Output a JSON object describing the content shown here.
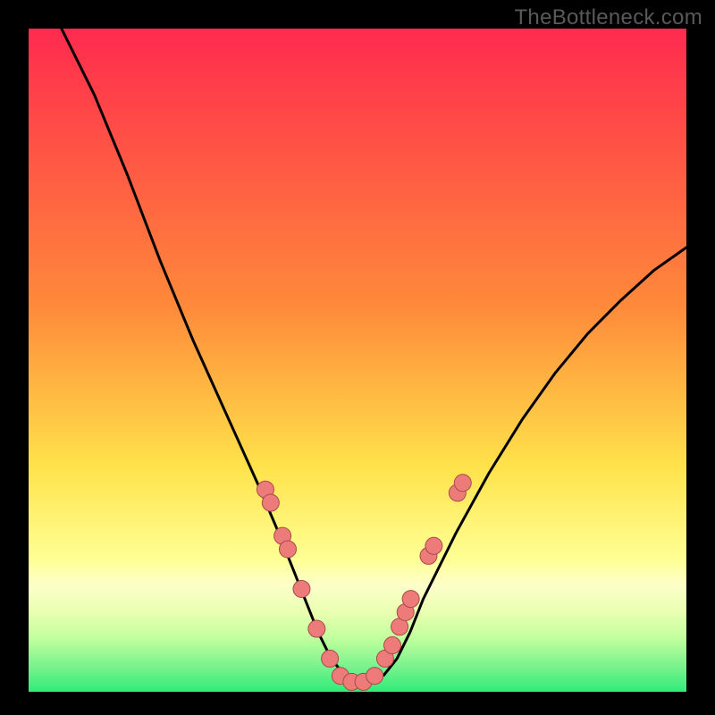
{
  "watermark": "TheBottleneck.com",
  "colors": {
    "black": "#000000",
    "gradient_top": "#ff2a4e",
    "gradient_mid1": "#ff8a3a",
    "gradient_mid2": "#ffe24a",
    "gradient_mid3": "#ffff94",
    "gradient_bottom": "#31eb79",
    "curve_stroke": "#000000",
    "dot_fill": "#ed7b7a",
    "dot_stroke": "#a84b4a"
  },
  "chart_data": {
    "type": "line",
    "title": "",
    "xlabel": "",
    "ylabel": "",
    "xlim": [
      0,
      100
    ],
    "ylim": [
      0,
      100
    ],
    "series": [
      {
        "name": "bottleneck-curve",
        "x": [
          5,
          10,
          15,
          20,
          25,
          30,
          35,
          38,
          40,
          42,
          44,
          46,
          48,
          50,
          52,
          54,
          56,
          58,
          60,
          65,
          70,
          75,
          80,
          85,
          90,
          95,
          100
        ],
        "y": [
          100,
          90,
          78,
          65,
          53,
          42,
          31,
          24,
          19,
          14,
          9,
          5,
          2.5,
          1.5,
          1.5,
          2.5,
          5,
          9,
          14,
          24,
          33,
          41,
          48,
          54,
          59,
          63.5,
          67
        ]
      }
    ],
    "dots": {
      "name": "data-markers",
      "points": [
        {
          "x": 36.0,
          "y": 30.5
        },
        {
          "x": 36.8,
          "y": 28.5
        },
        {
          "x": 38.6,
          "y": 23.5
        },
        {
          "x": 39.4,
          "y": 21.5
        },
        {
          "x": 41.5,
          "y": 15.5
        },
        {
          "x": 43.8,
          "y": 9.5
        },
        {
          "x": 45.8,
          "y": 5.0
        },
        {
          "x": 47.4,
          "y": 2.4
        },
        {
          "x": 49.1,
          "y": 1.5
        },
        {
          "x": 50.9,
          "y": 1.5
        },
        {
          "x": 52.6,
          "y": 2.4
        },
        {
          "x": 54.2,
          "y": 5.0
        },
        {
          "x": 55.3,
          "y": 7.0
        },
        {
          "x": 56.4,
          "y": 9.8
        },
        {
          "x": 57.3,
          "y": 12.0
        },
        {
          "x": 58.1,
          "y": 14.0
        },
        {
          "x": 60.8,
          "y": 20.5
        },
        {
          "x": 61.6,
          "y": 22.0
        },
        {
          "x": 65.2,
          "y": 30.0
        },
        {
          "x": 66.0,
          "y": 31.5
        }
      ]
    }
  }
}
